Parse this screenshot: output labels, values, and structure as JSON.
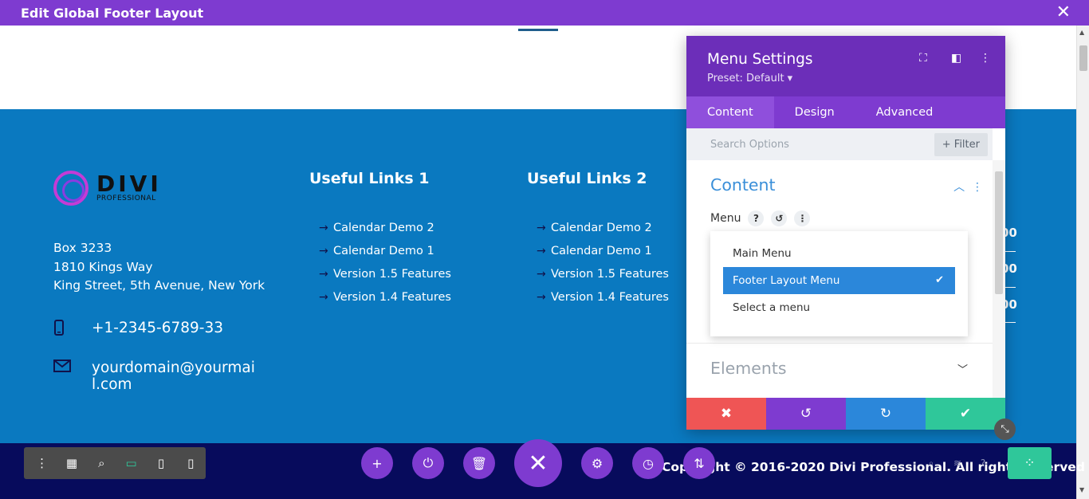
{
  "topbar": {
    "title": "Edit Global Footer Layout",
    "close": "✕"
  },
  "footer": {
    "logo": {
      "wordmark": "DIVI",
      "tagline": "PROFESSIONAL"
    },
    "address": [
      "Box 3233",
      "1810 Kings Way",
      "King Street, 5th Avenue, New York"
    ],
    "phone": "+1-2345-6789-33",
    "email": "yourdomain@yourmai l.com",
    "col1": {
      "title": "Useful Links 1",
      "links": [
        "Calendar Demo 2",
        "Calendar Demo 1",
        "Version 1.5 Features",
        "Version 1.4 Features"
      ]
    },
    "col2": {
      "title": "Useful Links 2",
      "links": [
        "Calendar Demo 2",
        "Calendar Demo 1",
        "Version 1.5 Features",
        "Version 1.4 Features"
      ]
    },
    "right_numbers": [
      "00",
      "00",
      "00"
    ],
    "copyright": "Copyright © 2016-2020 Divi Professional. All rights reserved"
  },
  "panel": {
    "title": "Menu Settings",
    "preset": "Preset: Default ▾",
    "tabs": [
      "Content",
      "Design",
      "Advanced"
    ],
    "search_placeholder": "Search Options",
    "filter_label": "+ Filter",
    "section_title": "Content",
    "menu_label": "Menu",
    "options": [
      "Main Menu",
      "Footer Layout Menu",
      "Select a menu"
    ],
    "elements_title": "Elements"
  },
  "colors": {
    "purple": "#7e3bd0",
    "footer_blue": "#0a79c0",
    "green": "#2fc79a",
    "red": "#ef5555",
    "blue": "#2b87da"
  }
}
